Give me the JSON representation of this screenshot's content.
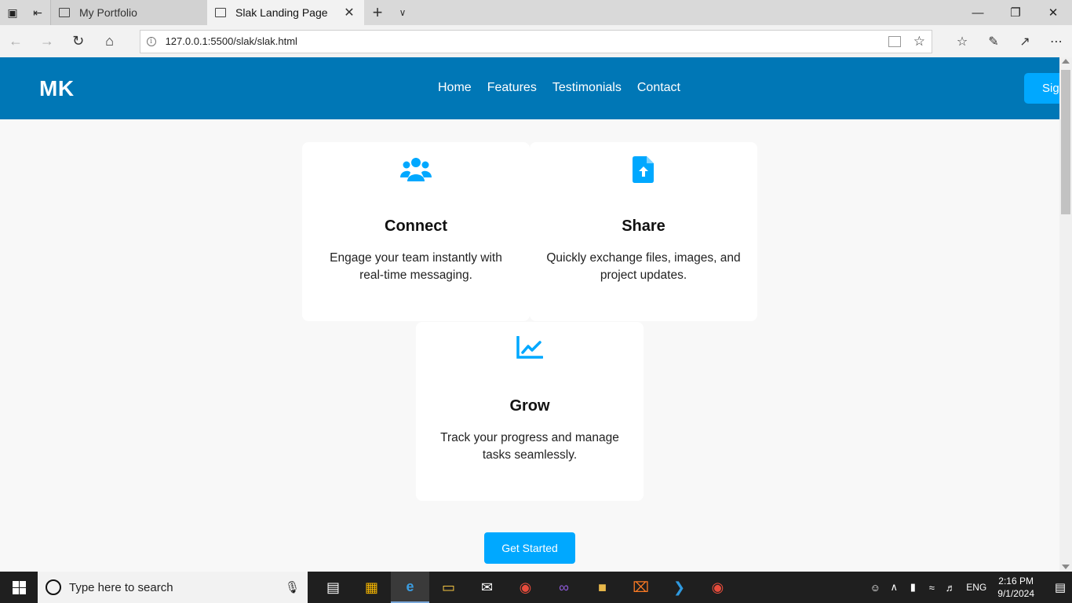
{
  "browser": {
    "tabs": [
      {
        "label": "My Portfolio",
        "active": false
      },
      {
        "label": "Slak Landing Page",
        "active": true
      }
    ],
    "address": "127.0.0.1:5500/slak/slak.html"
  },
  "site": {
    "logo": "MK",
    "menu": [
      "Home",
      "Features",
      "Testimonials",
      "Contact"
    ],
    "signup_label": "Sign",
    "accent": "#00a8ff",
    "header_bg": "#0077b6"
  },
  "features": [
    {
      "icon": "users-icon",
      "title": "Connect",
      "text": "Engage your team instantly with real-time messaging."
    },
    {
      "icon": "file-upload-icon",
      "title": "Share",
      "text": "Quickly exchange files, images, and project updates."
    },
    {
      "icon": "line-chart-icon",
      "title": "Grow",
      "text": "Track your progress and manage tasks seamlessly."
    }
  ],
  "cta_label": "Get Started",
  "taskbar": {
    "search_placeholder": "Type here to search",
    "lang": "ENG",
    "time": "2:16 PM",
    "date": "9/1/2024"
  }
}
